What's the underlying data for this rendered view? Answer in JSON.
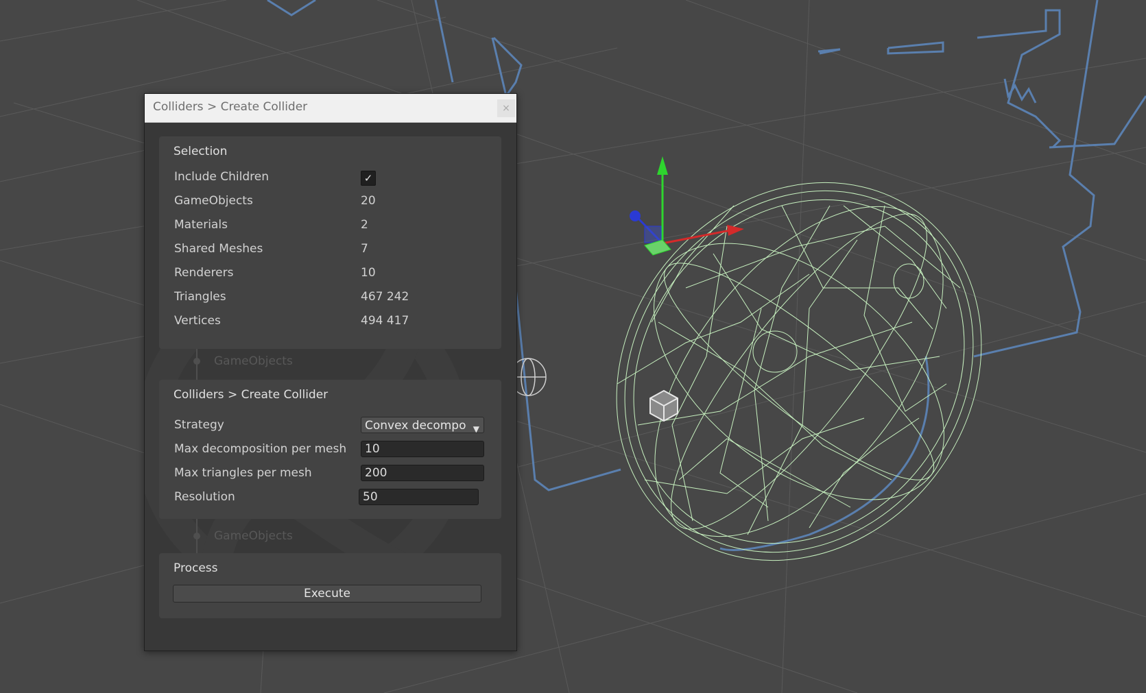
{
  "window": {
    "title": "Colliders > Create Collider",
    "close_glyph": "×"
  },
  "selection": {
    "title": "Selection",
    "include_children_label": "Include Children",
    "include_children_checked": true,
    "check_glyph": "✓",
    "rows": [
      {
        "label": "GameObjects",
        "value": "20"
      },
      {
        "label": "Materials",
        "value": "2"
      },
      {
        "label": "Shared Meshes",
        "value": "7"
      },
      {
        "label": "Renderers",
        "value": "10"
      },
      {
        "label": "Triangles",
        "value": "467 242"
      },
      {
        "label": "Vertices",
        "value": "494 417"
      }
    ]
  },
  "connectors": [
    {
      "label": "GameObjects"
    },
    {
      "label": "GameObjects"
    }
  ],
  "create_collider": {
    "title": "Colliders > Create Collider",
    "strategy_label": "Strategy",
    "strategy_value": "Convex decompo",
    "caret_glyph": "▼",
    "max_decomposition_label": "Max decomposition per mesh",
    "max_decomposition_value": "10",
    "max_triangles_label": "Max triangles per mesh",
    "max_triangles_value": "200",
    "resolution_label": "Resolution",
    "resolution_value": "50"
  },
  "process": {
    "title": "Process",
    "execute_label": "Execute"
  },
  "scene": {
    "background": "#474747",
    "grid_color": "#5a5a5a",
    "outline_color": "#5a7fae",
    "wireframe_color": "#c8f2c0",
    "gizmo_y_color": "#2ed52e",
    "gizmo_x_color": "#d42a2a",
    "gizmo_z_color": "#2a3ad4",
    "object_icon": "cube-icon"
  }
}
